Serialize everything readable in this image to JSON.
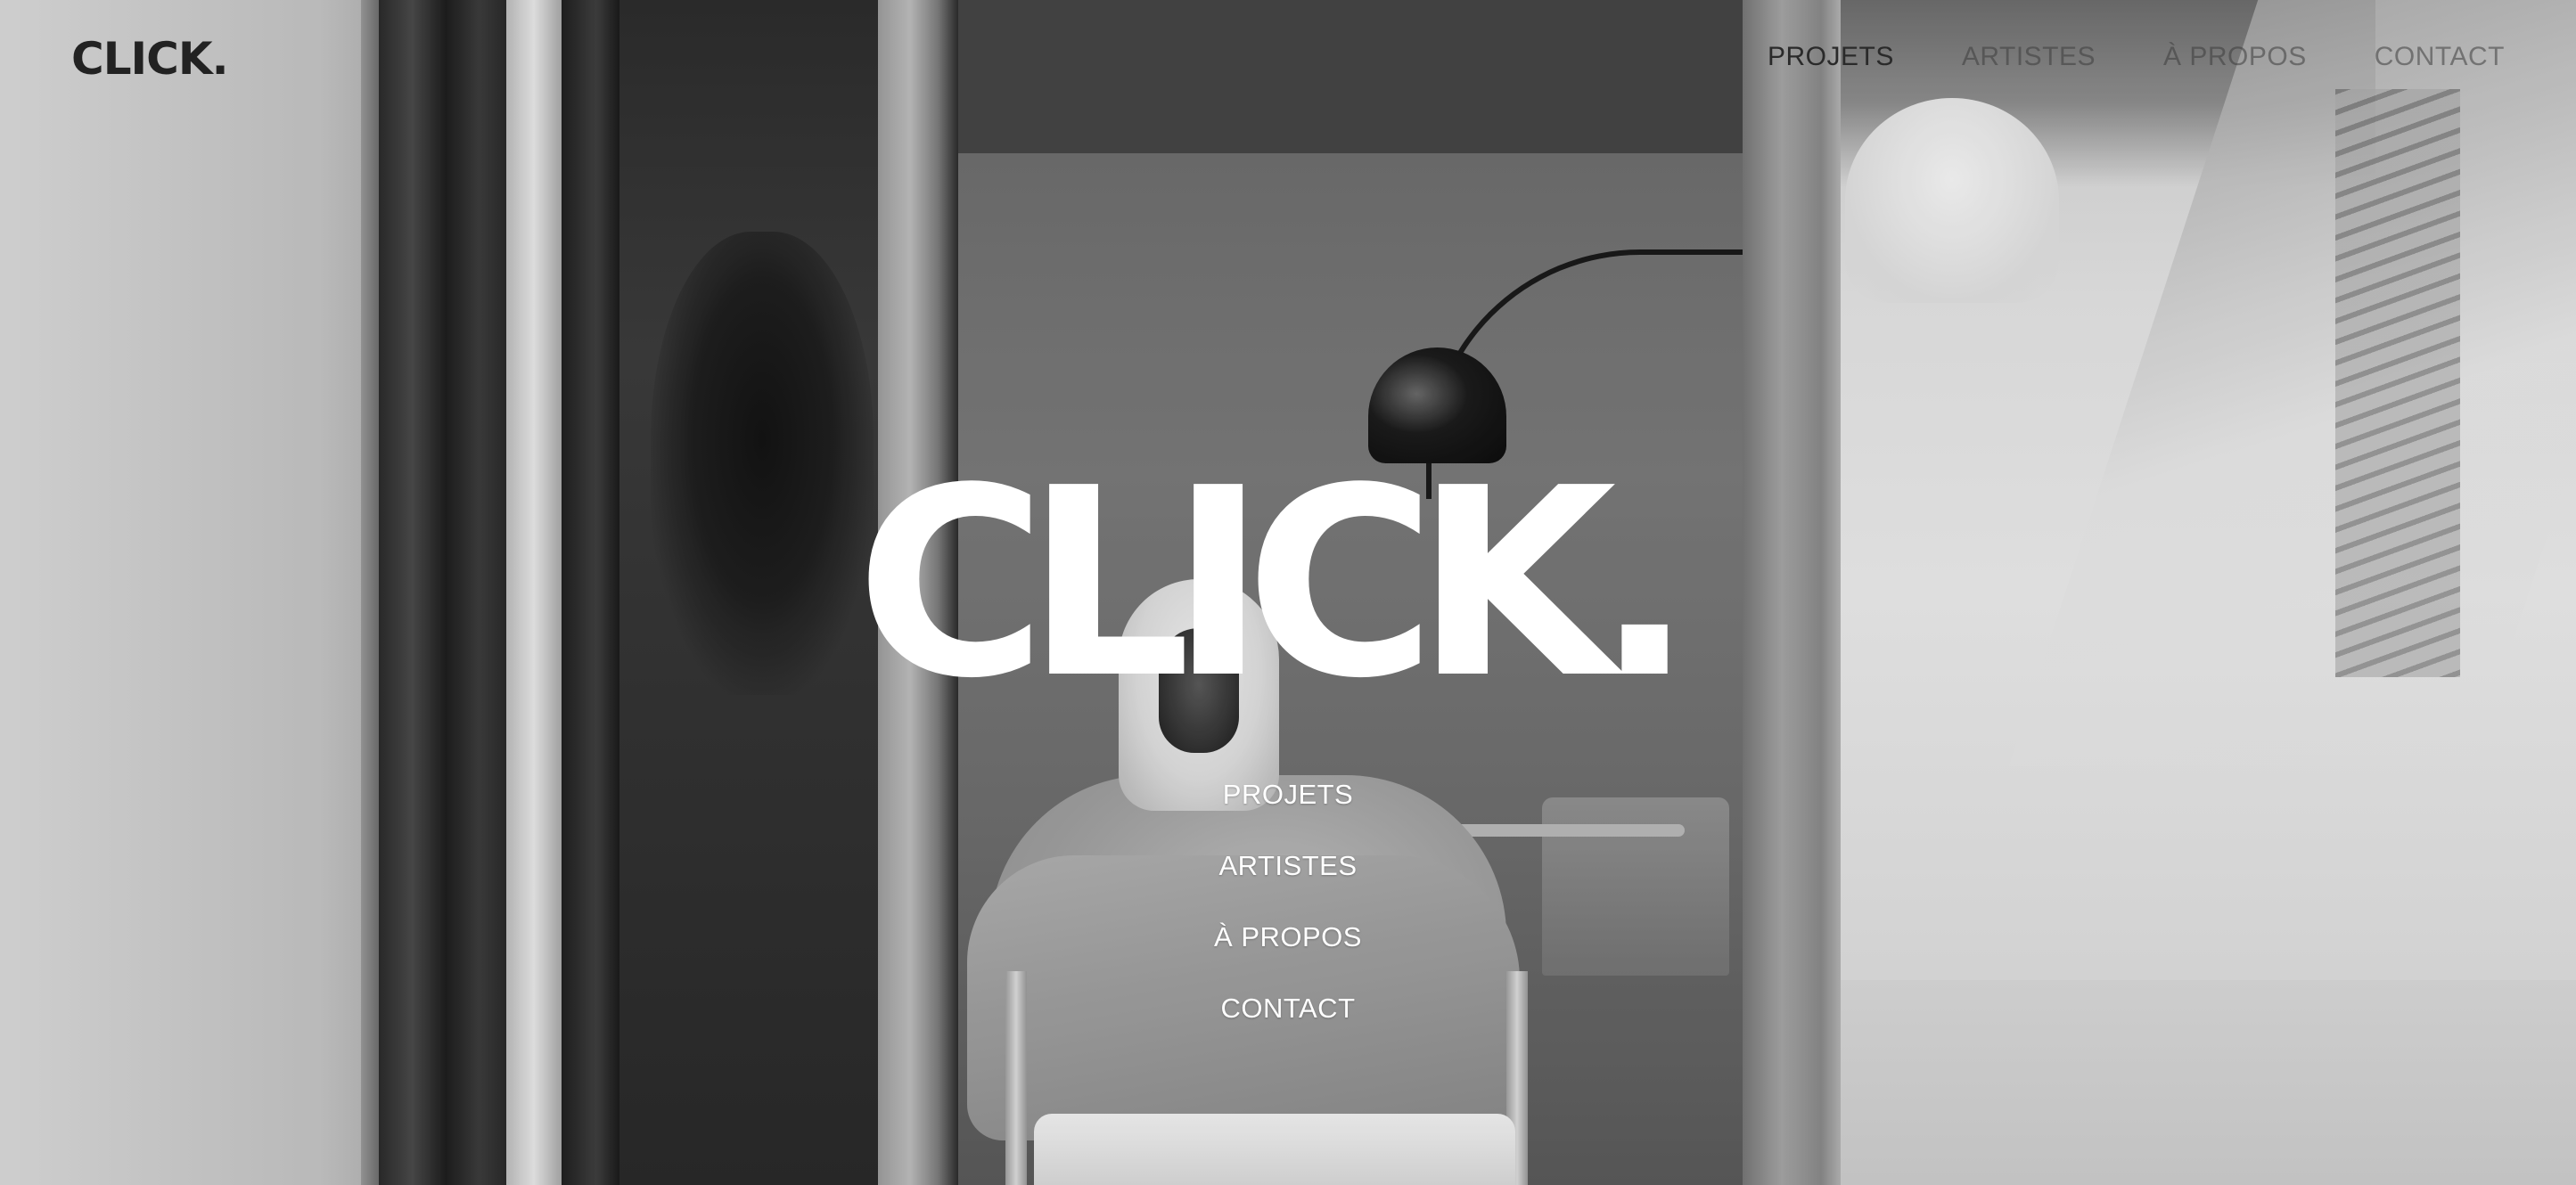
{
  "header": {
    "logo": "CLICK.",
    "nav": [
      {
        "label": "PROJETS"
      },
      {
        "label": "ARTISTES"
      },
      {
        "label": "À PROPOS"
      },
      {
        "label": "CONTACT"
      }
    ]
  },
  "hero": {
    "logo": "CLICK.",
    "menu": [
      {
        "label": "PROJETS"
      },
      {
        "label": "ARTISTES"
      },
      {
        "label": "À PROPOS"
      },
      {
        "label": "CONTACT"
      }
    ]
  },
  "colors": {
    "hero_text": "#ffffff",
    "header_text": "#222222"
  }
}
